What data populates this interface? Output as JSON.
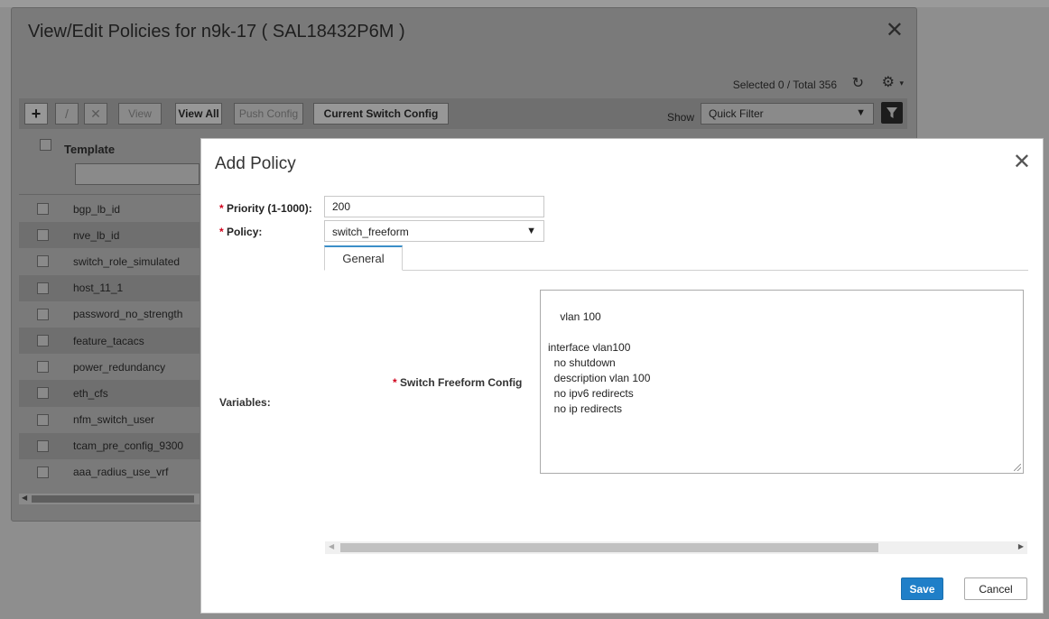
{
  "outer_dialog": {
    "title": "View/Edit Policies for n9k-17 ( SAL18432P6M )",
    "close_glyph": "✕",
    "selection_count": "Selected 0 / Total 356",
    "toolbar": {
      "add_glyph": "+",
      "edit_glyph": "/",
      "delete_glyph": "✕",
      "view_label": "View",
      "view_all_label": "View All",
      "push_config_label": "Push Config",
      "current_switch_config_label": "Current Switch Config",
      "show_label": "Show",
      "filter_value": "Quick Filter"
    },
    "grid": {
      "column_template": "Template",
      "rows": [
        {
          "label": "bgp_lb_id"
        },
        {
          "label": "nve_lb_id"
        },
        {
          "label": "switch_role_simulated"
        },
        {
          "label": "host_11_1"
        },
        {
          "label": "password_no_strength"
        },
        {
          "label": "feature_tacacs"
        },
        {
          "label": "power_redundancy"
        },
        {
          "label": "eth_cfs"
        },
        {
          "label": "nfm_switch_user"
        },
        {
          "label": "tcam_pre_config_9300"
        },
        {
          "label": "aaa_radius_use_vrf"
        }
      ]
    }
  },
  "add_policy": {
    "title": "Add Policy",
    "close_glyph": "✕",
    "required_marker": "*",
    "priority_label": "Priority (1-1000):",
    "priority_value": "200",
    "policy_label": "Policy:",
    "policy_value": "switch_freeform",
    "tab_general": "General",
    "variables_label": "Variables:",
    "switch_freeform_label": "Switch Freeform Config",
    "config_text": "vlan 100\n\ninterface vlan100\n  no shutdown\n  description vlan 100\n  no ipv6 redirects\n  no ip redirects",
    "save_label": "Save",
    "cancel_label": "Cancel"
  },
  "icons": {
    "refresh": "↻",
    "gear": "⚙",
    "caret_down": "▼",
    "caret_small": "▾",
    "arrow_left": "◀",
    "arrow_right": "▶"
  },
  "colors": {
    "save_button": "#1f7fc8",
    "required_marker": "#d0021b",
    "active_tab_accent": "#3b8ec8"
  }
}
